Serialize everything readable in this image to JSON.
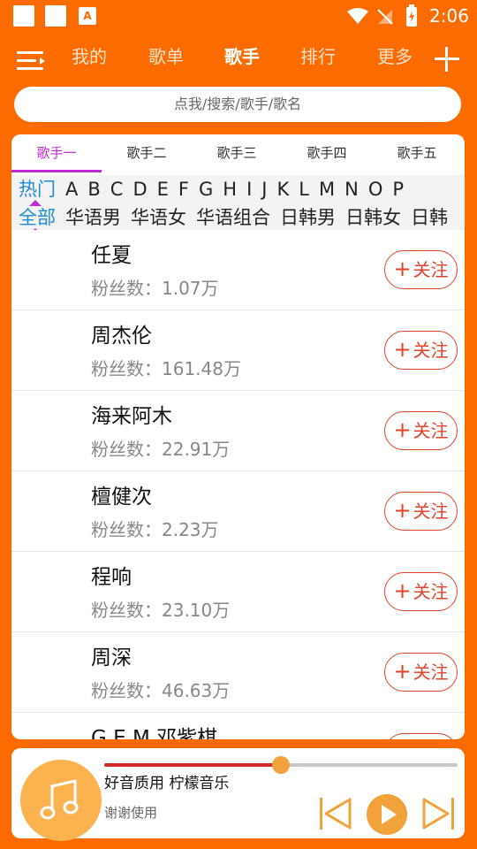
{
  "status_bar": {
    "time": "2:06",
    "notification_icon_letter": "A"
  },
  "nav": {
    "tabs": [
      "我的",
      "歌单",
      "歌手",
      "排行",
      "更多"
    ],
    "active_tab": "歌手"
  },
  "search": {
    "placeholder": "点我/搜索/歌手/歌名"
  },
  "sub_tabs": {
    "labels": [
      "歌手一",
      "歌手二",
      "歌手三",
      "歌手四",
      "歌手五"
    ],
    "active": "歌手一"
  },
  "filters": {
    "letters": [
      "热门",
      "A",
      "B",
      "C",
      "D",
      "E",
      "F",
      "G",
      "H",
      "I",
      "J",
      "K",
      "L",
      "M",
      "N",
      "O",
      "P"
    ],
    "selected_letter": "热门",
    "categories": [
      "全部",
      "华语男",
      "华语女",
      "华语组合",
      "日韩男",
      "日韩女",
      "日韩"
    ],
    "selected_category": "全部"
  },
  "singers": [
    {
      "name": "任夏",
      "fans_label": "粉丝数：",
      "fans": "1.07万"
    },
    {
      "name": "周杰伦",
      "fans_label": "粉丝数：",
      "fans": "161.48万"
    },
    {
      "name": "海来阿木",
      "fans_label": "粉丝数：",
      "fans": "22.91万"
    },
    {
      "name": "檀健次",
      "fans_label": "粉丝数：",
      "fans": "2.23万"
    },
    {
      "name": "程响",
      "fans_label": "粉丝数：",
      "fans": "23.10万"
    },
    {
      "name": "周深",
      "fans_label": "粉丝数：",
      "fans": "46.63万"
    },
    {
      "name": "G.E.M.邓紫棋",
      "fans_label": "",
      "fans": ""
    }
  ],
  "follow_label": "关注",
  "player": {
    "song": "好音质用 柠檬音乐",
    "subtitle": "谢谢使用",
    "progress": 0.5
  },
  "colors": {
    "brand": "#fb6b00",
    "accent_purple": "#c12bd6",
    "follow_red": "#e2432b",
    "player_orange": "#f1a23a",
    "progress_red": "#d72828",
    "selected_blue": "#1a8cd8"
  }
}
